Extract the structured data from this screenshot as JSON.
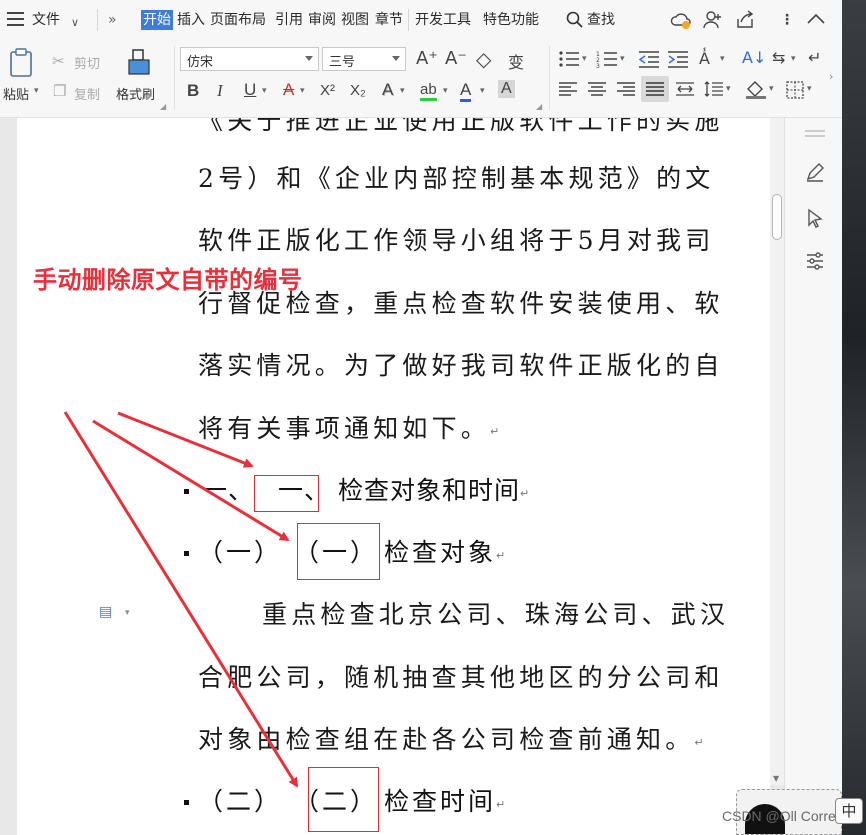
{
  "menubar": {
    "file": "文件",
    "more": "»",
    "tabs": [
      "开始",
      "插入",
      "页面布局",
      "引用",
      "审阅",
      "视图",
      "章节",
      "开发工具",
      "特色功能"
    ],
    "active_tab": "开始",
    "search": "查找"
  },
  "ribbon": {
    "paste": "粘贴",
    "cut": "剪切",
    "copy": "复制",
    "format_painter": "格式刷",
    "font_name": "仿宋",
    "font_size": "三号",
    "bold": "B",
    "italic": "I",
    "underline": "U",
    "strike": "A",
    "superscript": "X²",
    "subscript": "X₂",
    "text_effect": "A",
    "highlight": "ab",
    "font_color": "A",
    "char_shading": "A",
    "grow_font": "A⁺",
    "shrink_font": "A⁻",
    "clear_format": "◇",
    "phonetic": "变"
  },
  "document": {
    "lines": [
      "《关于推进企业使用正版软件工作的实施",
      "2号）和《企业内部控制基本规范》的文",
      "软件正版化工作领导小组将于5月对我司",
      "行督促检查，重点检查软件安装使用、软",
      "落实情况。为了做好我司软件正版化的自",
      "将有关事项通知如下。"
    ],
    "para_mark": "↵",
    "h1_auto": "一、",
    "h1_manual": "一、",
    "h1_text": "检查对象和时间",
    "h2a_auto": "（一）",
    "h2a_manual": "（一）",
    "h2a_text": "检查对象",
    "body2": [
      "重点检查北京公司、珠海公司、武汉",
      "合肥公司，随机抽查其他地区的分公司和",
      "对象由检查组在赴各公司检查前通知。"
    ],
    "h2b_auto": "（二）",
    "h2b_manual": "（二）",
    "h2b_text": "检查时间"
  },
  "annotation": {
    "text": "手动删除原文自带的编号",
    "color": "#e8303a"
  },
  "status": {
    "ime": "中",
    "watermark": "CSDN @Oll Correct"
  },
  "colors": {
    "accent": "#3f7bd9",
    "annotation_red": "#e8303a",
    "box_red": "#d8312f"
  }
}
